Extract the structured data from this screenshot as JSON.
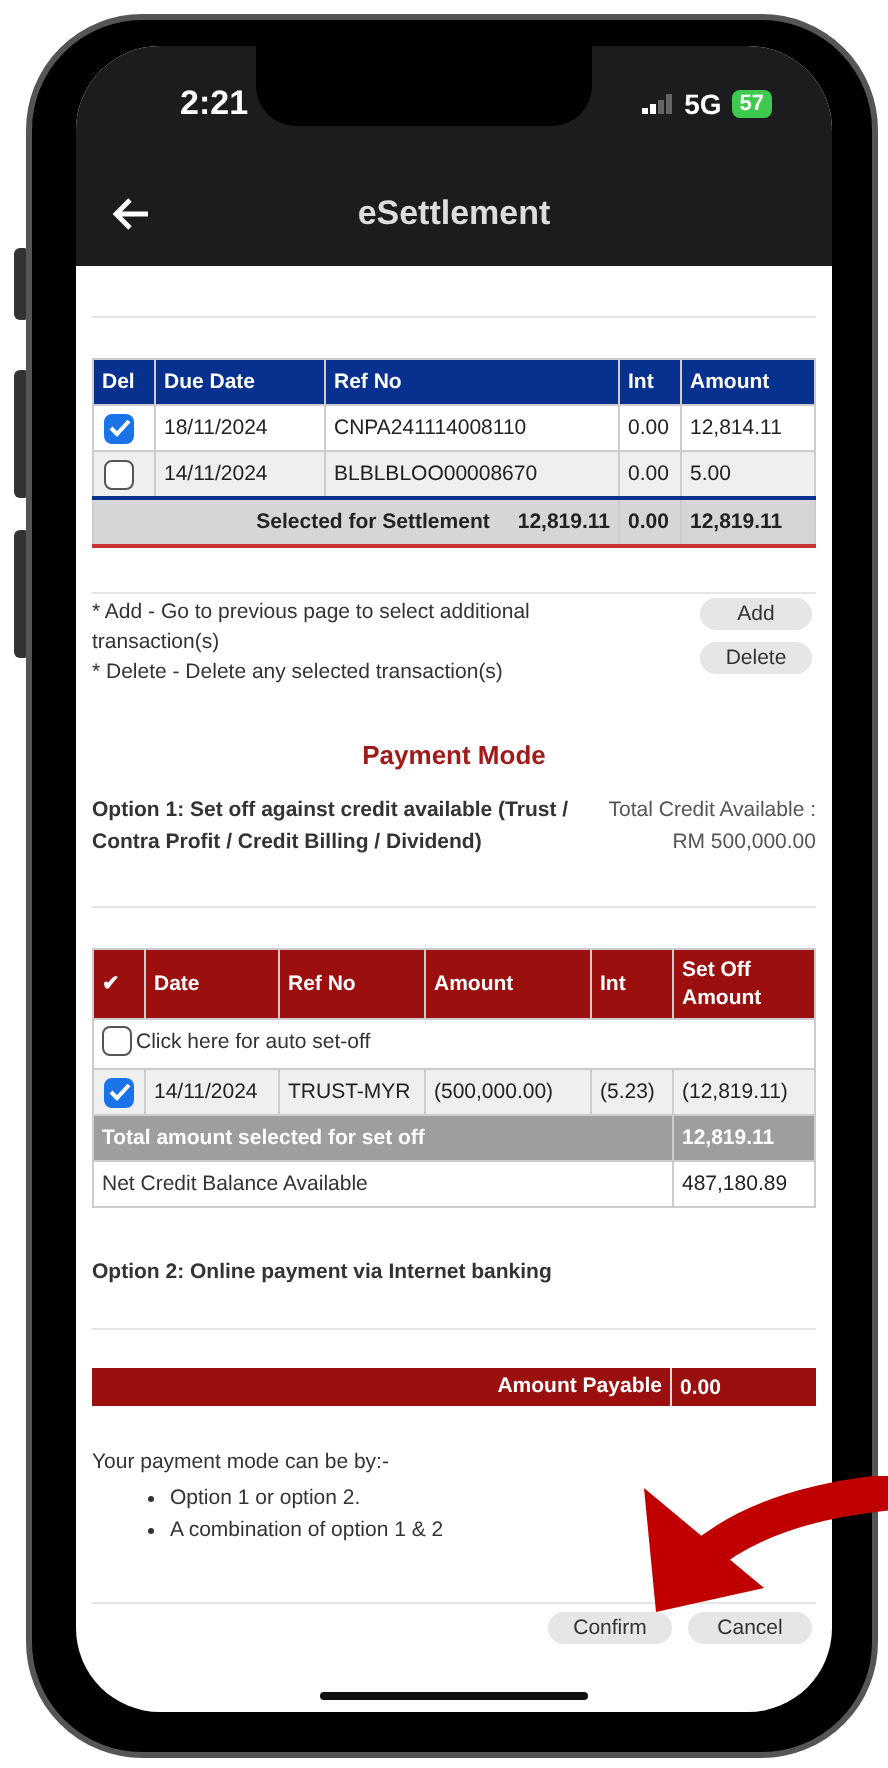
{
  "status_bar": {
    "time": "2:21",
    "network": "5G",
    "battery": "57"
  },
  "header": {
    "title": "eSettlement"
  },
  "settlement_table": {
    "columns": [
      "Del",
      "Due Date",
      "Ref No",
      "Int",
      "Amount"
    ],
    "rows": [
      {
        "selected": true,
        "due_date": "18/11/2024",
        "ref_no": "CNPA241114008110",
        "int": "0.00",
        "amount": "12,814.11"
      },
      {
        "selected": false,
        "due_date": "14/11/2024",
        "ref_no": "BLBLBLOO00008670",
        "int": "0.00",
        "amount": "5.00"
      }
    ],
    "summary": {
      "label": "Selected for Settlement",
      "total": "12,819.11",
      "int": "0.00",
      "amount": "12,819.11"
    }
  },
  "notes": [
    "* Add - Go to previous page to select additional transaction(s)",
    "* Delete - Delete any selected transaction(s)"
  ],
  "actions": [
    "Add",
    "Delete"
  ],
  "payment_mode": {
    "title": "Payment Mode",
    "option1": "Option 1: Set off against credit available (Trust / Contra Profit / Credit Billing / Dividend)",
    "credit_label": "Total Credit Available :",
    "credit_value": "RM 500,000.00"
  },
  "setoff_table": {
    "columns": [
      "✔",
      "Date",
      "Ref No",
      "Amount",
      "Int",
      "Set Off Amount"
    ],
    "auto_setoff": {
      "label": "Click here for auto set-off",
      "checked": false
    },
    "rows": [
      {
        "selected": true,
        "date": "14/11/2024",
        "ref_no": "TRUST-MYR",
        "amount": "(500,000.00)",
        "int": "(5.23)",
        "set_off": "(12,819.11)"
      }
    ],
    "total": {
      "label": "Total amount selected for set off",
      "value": "12,819.11"
    },
    "net": {
      "label": "Net Credit Balance Available",
      "value": "487,180.89"
    }
  },
  "option2": "Option 2: Online payment via Internet banking",
  "amount_payable": {
    "label": "Amount Payable",
    "value": "0.00"
  },
  "info": {
    "intro": "Your payment mode can be by:-",
    "items": [
      "Option 1 or option 2.",
      "A combination of option 1 & 2"
    ]
  },
  "buttons": [
    "Confirm",
    "Cancel"
  ]
}
